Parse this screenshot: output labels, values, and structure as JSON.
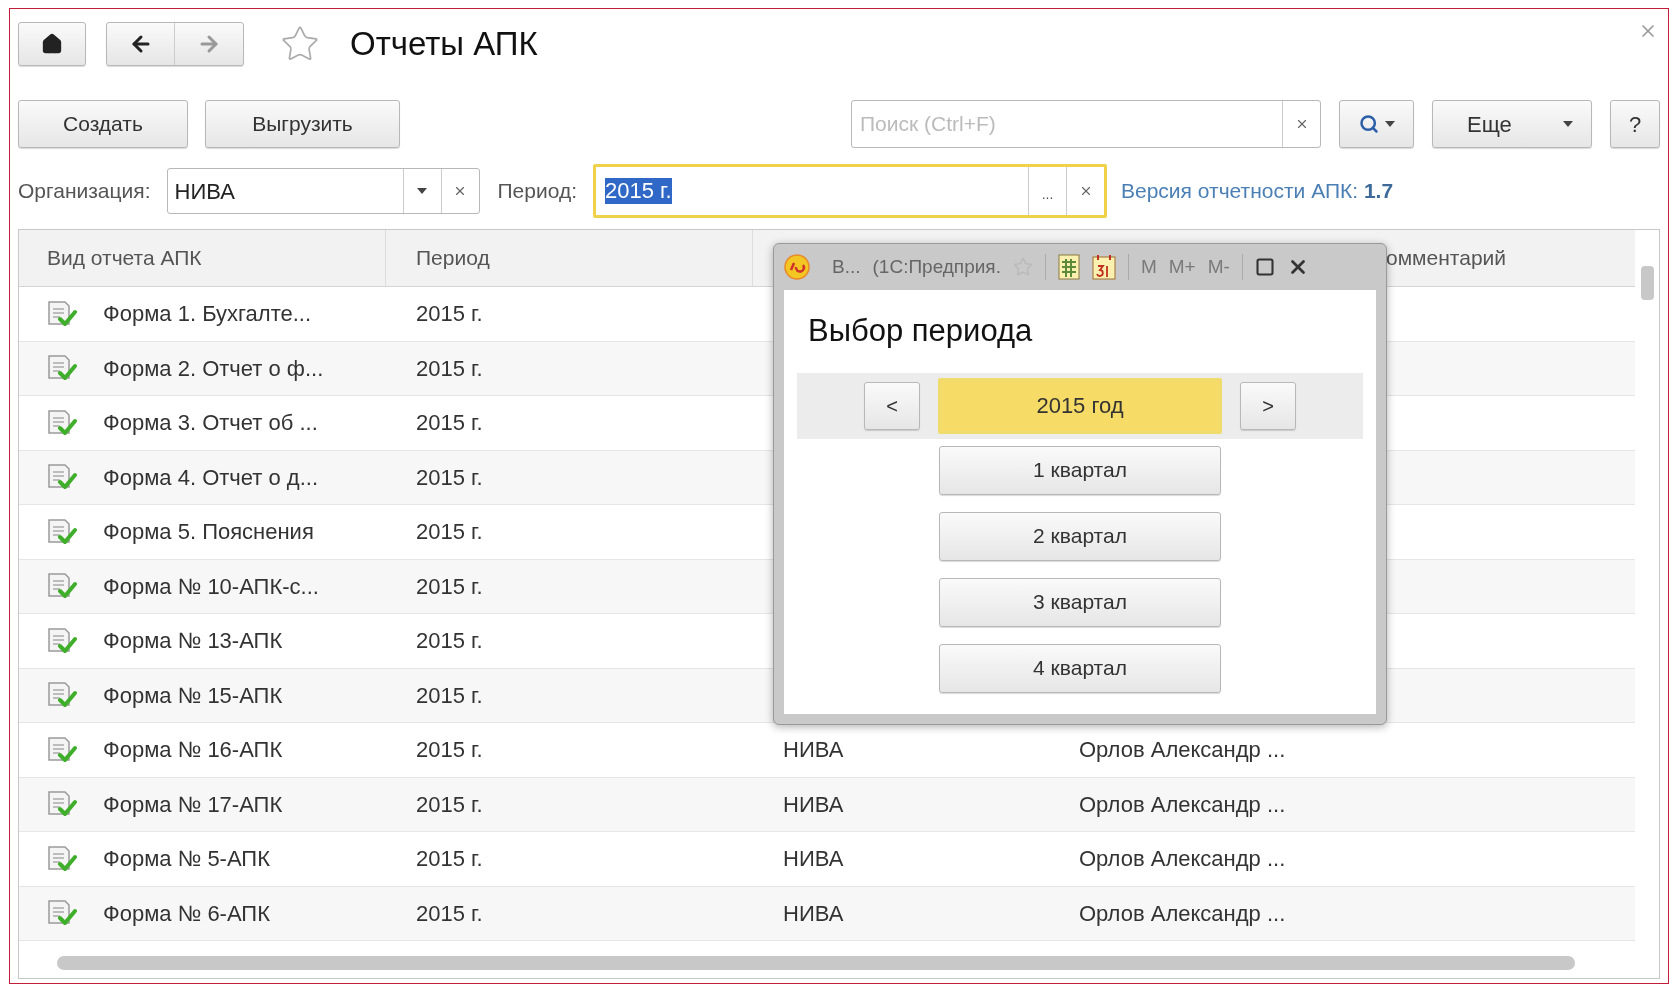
{
  "window": {
    "title": "Отчеты АПК"
  },
  "toolbar": {
    "buttons": [
      "Создать",
      "Выгрузить"
    ],
    "search": {
      "placeholder": "Поиск (Ctrl+F)"
    },
    "more": "Еще",
    "help": "?"
  },
  "filters": {
    "organization": {
      "label": "Организация:",
      "value": "НИВА"
    },
    "period": {
      "label": "Период:",
      "value": "2015 г.",
      "focused": true,
      "choose": "..."
    },
    "version": {
      "label": "Версия отчетности АПК:",
      "value": "1.7"
    }
  },
  "table": {
    "header": {
      "report": "Вид отчета АПК",
      "period": "Период",
      "column_5": "омментарий"
    },
    "rows": [
      {
        "report": "Форма 1. Бухгалте...",
        "period": "2015 г."
      },
      {
        "report": "Форма 2. Отчет о ф...",
        "period": "2015 г."
      },
      {
        "report": "Форма 3. Отчет об ...",
        "period": "2015 г."
      },
      {
        "report": "Форма 4. Отчет о д...",
        "period": "2015 г."
      },
      {
        "report": "Форма 5. Пояснения",
        "period": "2015 г."
      },
      {
        "report": "Форма № 10-АПК-с...",
        "period": "2015 г."
      },
      {
        "report": "Форма № 13-АПК",
        "period": "2015 г."
      },
      {
        "report": "Форма № 15-АПК",
        "period": "2015 г."
      },
      {
        "report": "Форма № 16-АПК",
        "period": "2015 г.",
        "column_3": "НИВА",
        "column_4": "Орлов Александр ..."
      },
      {
        "report": "Форма № 17-АПК",
        "period": "2015 г.",
        "column_3": "НИВА",
        "column_4": "Орлов Александр ..."
      },
      {
        "report": "Форма № 5-АПК",
        "period": "2015 г.",
        "column_3": "НИВА",
        "column_4": "Орлов Александр ..."
      },
      {
        "report": "Форма № 6-АПК",
        "period": "2015 г.",
        "column_3": "НИВА",
        "column_4": "Орлов Александр ..."
      }
    ]
  },
  "popup": {
    "title": "В...",
    "app": "(1С:Предприя.",
    "memory_buttons": [
      {
        "label": "M",
        "disabled": true
      },
      {
        "label": "M+",
        "disabled": true
      },
      {
        "label": "M-",
        "disabled": true
      }
    ],
    "heading": "Выбор периода",
    "year": {
      "prev": "<",
      "label": "2015 год",
      "next": ">",
      "selected": true
    },
    "quarters": [
      {
        "label": "1 квартал",
        "selected": false
      },
      {
        "label": "2 квартал",
        "selected": false
      },
      {
        "label": "3 квартал",
        "selected": false
      },
      {
        "label": "4 квартал",
        "selected": false
      }
    ]
  }
}
